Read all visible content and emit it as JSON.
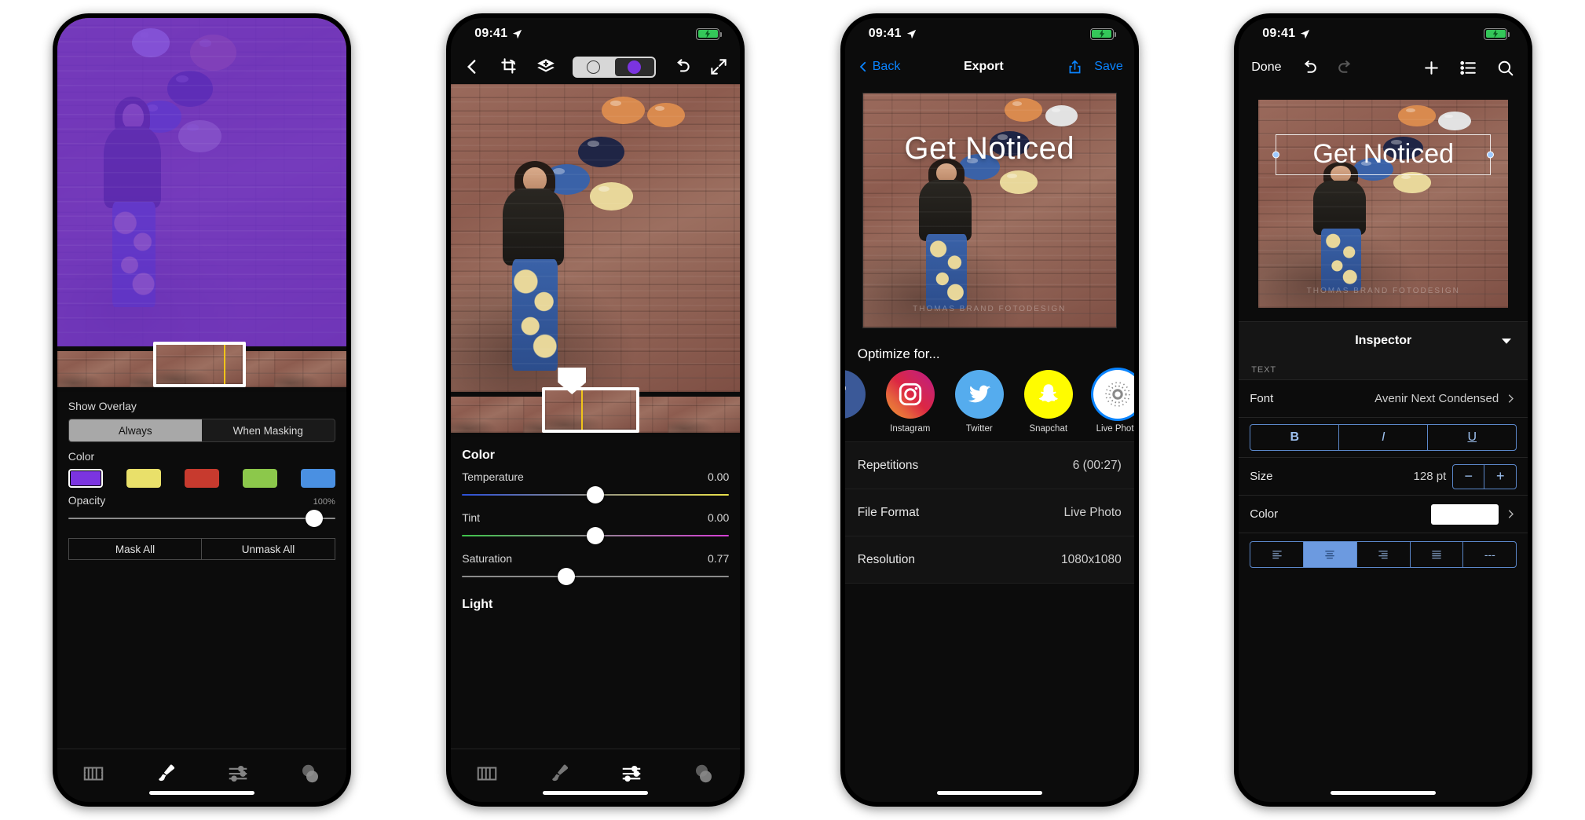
{
  "status": {
    "time": "09:41",
    "location_icon": "location-arrow-icon",
    "battery_icon": "battery-charging-icon"
  },
  "phone1": {
    "name": "mask-overlay-screen",
    "show_overlay_label": "Show Overlay",
    "segmented": {
      "options": [
        "Always",
        "When Masking"
      ],
      "selected": "Always"
    },
    "color_label": "Color",
    "swatches": [
      {
        "name": "purple",
        "hex": "#7B34E0",
        "selected": true
      },
      {
        "name": "yellow",
        "hex": "#E9E06A",
        "selected": false
      },
      {
        "name": "red",
        "hex": "#C73A2E",
        "selected": false
      },
      {
        "name": "green",
        "hex": "#8CC84B",
        "selected": false
      },
      {
        "name": "blue",
        "hex": "#4A90E2",
        "selected": false
      }
    ],
    "opacity": {
      "label": "Opacity",
      "value": "100%",
      "percent": 100
    },
    "buttons": {
      "mask_all": "Mask All",
      "unmask_all": "Unmask All"
    },
    "tabs": [
      {
        "name": "filmstrip-tab",
        "icon": "film-icon",
        "active": false
      },
      {
        "name": "brush-tab",
        "icon": "brush-icon",
        "active": true
      },
      {
        "name": "adjust-tab",
        "icon": "sliders-icon",
        "active": false
      },
      {
        "name": "layers-tab",
        "icon": "circles-icon",
        "active": false
      }
    ]
  },
  "phone2": {
    "name": "color-adjust-screen",
    "toolbar": [
      {
        "name": "back-button",
        "icon": "chevron-left-icon"
      },
      {
        "name": "crop-rotate-button",
        "icon": "crop-rotate-icon"
      },
      {
        "name": "layers-button",
        "icon": "layers-add-icon"
      },
      {
        "name": "mask-toggle",
        "icon": "mask-toggle-segment"
      },
      {
        "name": "undo-button",
        "icon": "undo-icon"
      },
      {
        "name": "expand-button",
        "icon": "expand-icon"
      }
    ],
    "color_section": "Color",
    "sliders": [
      {
        "label": "Temperature",
        "value": "0.00",
        "percent": 50,
        "gradient": "blue-yellow"
      },
      {
        "label": "Tint",
        "value": "0.00",
        "percent": 50,
        "gradient": "green-magenta"
      },
      {
        "label": "Saturation",
        "value": "0.77",
        "percent": 39,
        "gradient": "plain"
      }
    ],
    "light_section": "Light",
    "tabs": [
      {
        "name": "filmstrip-tab",
        "icon": "film-icon",
        "active": false
      },
      {
        "name": "brush-tab",
        "icon": "brush-icon",
        "active": false
      },
      {
        "name": "adjust-tab",
        "icon": "sliders-icon",
        "active": true
      },
      {
        "name": "layers-tab",
        "icon": "circles-icon",
        "active": false
      }
    ]
  },
  "phone3": {
    "name": "export-screen",
    "nav": {
      "back": "Back",
      "title": "Export",
      "share_icon": "share-icon",
      "save": "Save"
    },
    "preview_text": "Get Noticed",
    "optimize_label": "Optimize for...",
    "socials": [
      {
        "name": "facebook",
        "label": "",
        "hex": "#3B5998",
        "selected": false
      },
      {
        "name": "instagram",
        "label": "Instagram",
        "hex": "#E1306C",
        "selected": false
      },
      {
        "name": "twitter",
        "label": "Twitter",
        "hex": "#55ACEE",
        "selected": false
      },
      {
        "name": "snapchat",
        "label": "Snapchat",
        "hex": "#FFFC00",
        "selected": false
      },
      {
        "name": "live-photo",
        "label": "Live Photo",
        "hex": "#FFFFFF",
        "selected": true
      }
    ],
    "rows": [
      {
        "label": "Repetitions",
        "value": "6 (00:27)"
      },
      {
        "label": "File Format",
        "value": "Live Photo"
      },
      {
        "label": "Resolution",
        "value": "1080x1080"
      }
    ]
  },
  "phone4": {
    "name": "text-inspector-screen",
    "nav": {
      "done": "Done",
      "undo_icon": "undo-icon",
      "redo_icon": "redo-icon",
      "add_icon": "plus-icon",
      "list_icon": "list-icon",
      "search_icon": "search-icon"
    },
    "canvas_text": "Get Noticed",
    "inspector": {
      "title": "Inspector",
      "caret_icon": "chevron-down-icon"
    },
    "section_caption": "TEXT",
    "font": {
      "label": "Font",
      "value": "Avenir Next Condensed",
      "chevron": "chevron-right-icon"
    },
    "style_buttons": [
      {
        "name": "bold",
        "label": "B"
      },
      {
        "name": "italic",
        "label": "I"
      },
      {
        "name": "underline",
        "label": "U"
      }
    ],
    "size": {
      "label": "Size",
      "value": "128 pt",
      "minus": "−",
      "plus": "+"
    },
    "color": {
      "label": "Color",
      "swatch_hex": "#FFFFFF",
      "chevron": "chevron-right-icon"
    },
    "alignment": {
      "options": [
        {
          "name": "align-left",
          "selected": false
        },
        {
          "name": "align-center",
          "selected": true
        },
        {
          "name": "align-right",
          "selected": false
        },
        {
          "name": "align-justify",
          "selected": false
        },
        {
          "name": "align-none",
          "label": "---",
          "selected": false
        }
      ]
    }
  }
}
